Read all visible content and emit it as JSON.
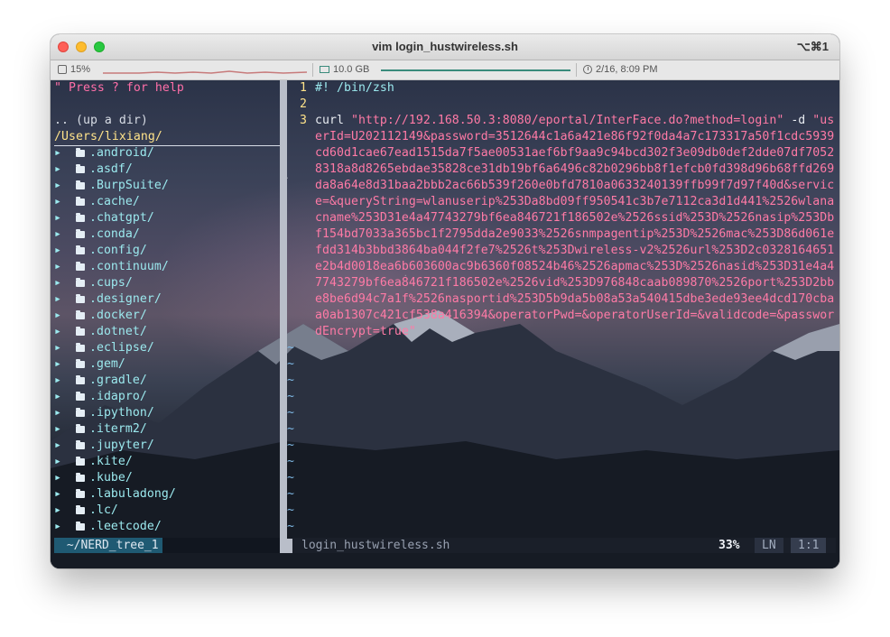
{
  "window": {
    "title": "vim login_hustwireless.sh",
    "shortcut": "⌥⌘1"
  },
  "status": {
    "cpu": "15%",
    "memory": "10.0 GB",
    "datetime": "2/16, 8:09 PM"
  },
  "nerdtree": {
    "help": "\" Press ? for help",
    "up_dir": ".. (up a dir)",
    "cwd": "/Users/lixiang/",
    "items": [
      ".android/",
      ".asdf/",
      ".BurpSuite/",
      ".cache/",
      ".chatgpt/",
      ".conda/",
      ".config/",
      ".continuum/",
      ".cups/",
      ".designer/",
      ".docker/",
      ".dotnet/",
      ".eclipse/",
      ".gem/",
      ".gradle/",
      ".idapro/",
      ".ipython/",
      ".iterm2/",
      ".jupyter/",
      ".kite/",
      ".kube/",
      ".labuladong/",
      ".lc/",
      ".leetcode/"
    ],
    "status_label": " ~/NERD_tree_1"
  },
  "editor": {
    "line_numbers": [
      "1",
      "2",
      "3"
    ],
    "line1_shebang": "#!",
    "line1_path": " /bin/zsh",
    "curl_cmd": "curl ",
    "url": "\"http://192.168.50.3:8080/eportal/InterFace.do?method=login\"",
    "flag": " -d ",
    "data_lines": [
      "\"us",
      "erId=U202112149&password=3512644c1a6a421e86f92f0da4a7c173317a50f1cdc5939",
      "cd60d1cae67ead1515da7f5ae00531aef6bf9aa9c94bcd302f3e09db0def2dde07df7052",
      "8318a8d8265ebdae35828ce31db19bf6a6496c82b0296bb8f1efcb0fd398d96b68ffd269",
      "da8a64e8d31baa2bbb2ac66b539f260e0bfd7810a0633240139ffb99f7d97f40d&servic",
      "e=&queryString=wlanuserip%253Da8bd09ff950541c3b7e7112ca3d1d441%2526wlana",
      "cname%253D31e4a47743279bf6ea846721f186502e%2526ssid%253D%2526nasip%253Db",
      "f154bd7033a365bc1f2795dda2e9033%2526snmpagentip%253D%2526mac%253D86d061e",
      "fdd314b3bbd3864ba044f2fe7%2526t%253Dwireless-v2%2526url%253D2c0328164651",
      "e2b4d0018ea6b603600ac9b6360f08524b46%2526apmac%253D%2526nasid%253D31e4a4",
      "7743279bf6ea846721f186502e%2526vid%253D976848caab089870%2526port%253D2bb",
      "e8be6d94c7a1f%2526nasportid%253D5b9da5b08a53a540415dbe3ede93ee4dcd170cba",
      "a0ab1307c421cf538a416394&operatorPwd=&operatorUserId=&validcode=&passwor",
      "dEncrypt=true\""
    ],
    "tilde": "~",
    "filename": "login_hustwireless.sh",
    "percent": "33%",
    "ln_label": "LN",
    "position": "1:1"
  }
}
